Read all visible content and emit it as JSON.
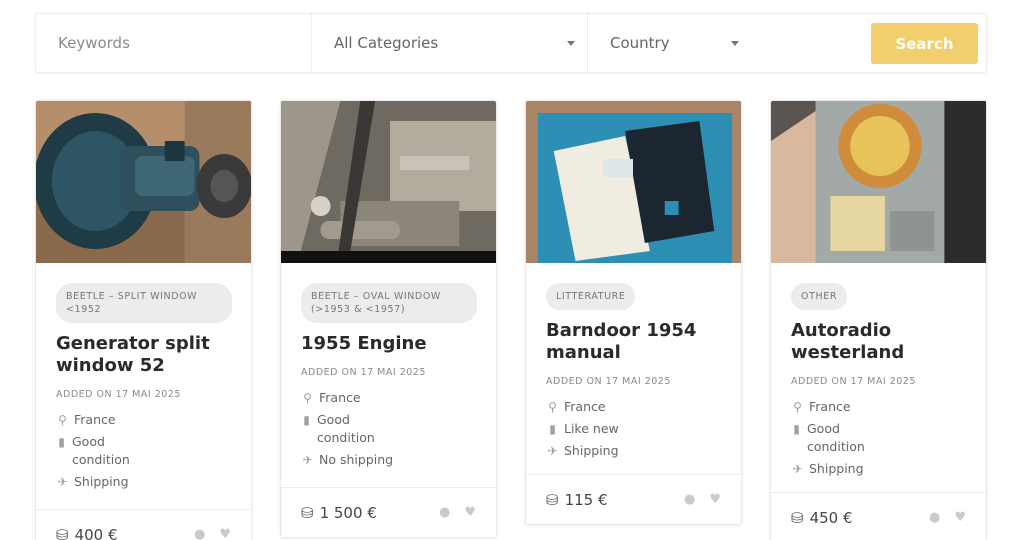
{
  "search": {
    "keywords_placeholder": "Keywords",
    "category_value": "All Categories",
    "country_value": "Country",
    "button_label": "Search",
    "button_color": "#f0cf6c"
  },
  "cards": [
    {
      "category": "BEETLE – SPLIT WINDOW <1952",
      "title": "Generator split window 52",
      "added": "ADDED ON 17 MAI 2025",
      "location": "France",
      "condition": "Good condition",
      "shipping": "Shipping",
      "price": "400 €"
    },
    {
      "category": "BEETLE – OVAL WINDOW (>1953 & <1957)",
      "title": "1955 Engine",
      "added": "ADDED ON 17 MAI 2025",
      "location": "France",
      "condition": "Good condition",
      "shipping": "No shipping",
      "price": "1 500 €"
    },
    {
      "category": "LITTERATURE",
      "title": "Barndoor 1954 manual",
      "added": "ADDED ON 17 MAI 2025",
      "location": "France",
      "condition": "Like new",
      "shipping": "Shipping",
      "price": "115 €"
    },
    {
      "category": "OTHER",
      "title": "Autoradio westerland",
      "added": "ADDED ON 17 MAI 2025",
      "location": "France",
      "condition": "Good condition",
      "shipping": "Shipping",
      "price": "450 €"
    }
  ],
  "icons": {
    "location": "search-location-icon",
    "condition": "bookmark-icon",
    "shipping": "plane-icon",
    "price": "coins-icon",
    "message": "comment-icon",
    "favorite": "heart-icon"
  }
}
